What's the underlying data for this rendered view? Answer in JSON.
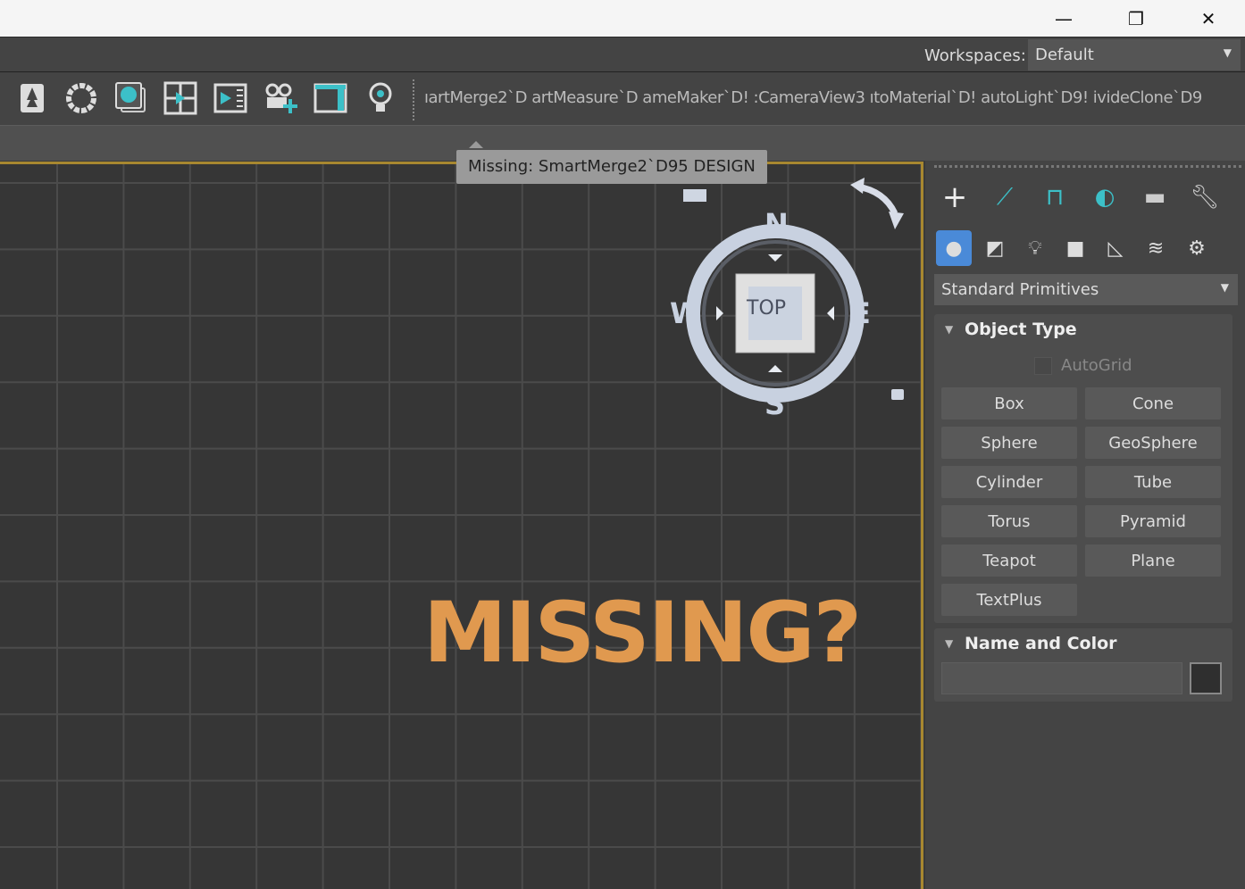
{
  "window": {
    "controls": [
      "minimize",
      "restore",
      "close"
    ]
  },
  "workspaces": {
    "label": "Workspaces:",
    "value": "Default"
  },
  "toolbar": {
    "icons": [
      "tree-icon",
      "gear-icon",
      "material-icon",
      "viewport-layout-icon",
      "render-frame-icon",
      "camera-add-icon",
      "panel-layout-icon",
      "lightbulb-icon"
    ],
    "scripts_text": "ıartMerge2`D artMeasure`D ameMaker`D! :CameraView3 ıtoMaterial`D! autoLight`D9! ivideClone`D9"
  },
  "tooltip": "Missing: SmartMerge2`D95 DESIGN",
  "overlay_text": "MISSING?",
  "viewcube": {
    "face": "TOP",
    "north": "N",
    "south": "S",
    "east": "E",
    "west": "W"
  },
  "panel": {
    "category": "Standard Primitives",
    "object_type": {
      "title": "Object Type",
      "autogrid": "AutoGrid",
      "buttons": [
        "Box",
        "Cone",
        "Sphere",
        "GeoSphere",
        "Cylinder",
        "Tube",
        "Torus",
        "Pyramid",
        "Teapot",
        "Plane",
        "TextPlus"
      ]
    },
    "name_color": {
      "title": "Name and Color",
      "name_value": "",
      "color": "#2f2f2f"
    }
  },
  "colors": {
    "accent": "#a88830",
    "missing": "#e0994f",
    "active_tab": "#4a8ad8"
  }
}
